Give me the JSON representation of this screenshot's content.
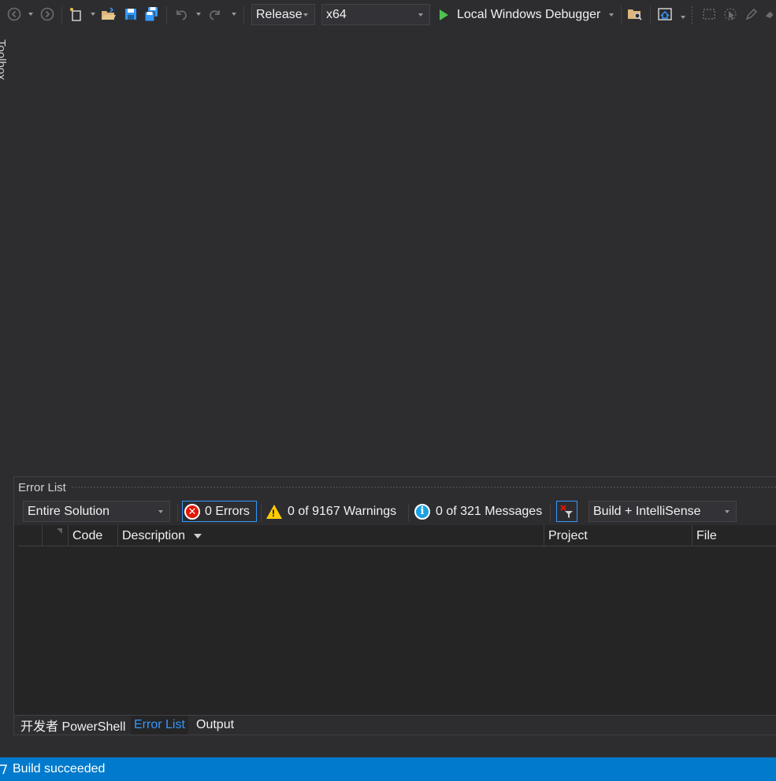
{
  "toolbar": {
    "configuration": "Release",
    "platform": "x64",
    "run_label": "Local Windows Debugger",
    "icons": [
      "back-icon",
      "forward-icon",
      "new-project-icon",
      "open-file-icon",
      "save-icon",
      "save-all-icon",
      "undo-icon",
      "redo-icon",
      "find-in-files-icon",
      "browser-icon",
      "select-icon",
      "cursor-icon",
      "pen-icon"
    ]
  },
  "side_tabs": {
    "toolbox": "Toolbox"
  },
  "error_list": {
    "title": "Error List",
    "scope": "Entire Solution",
    "errors_label": "0 Errors",
    "warnings_label": "0 of 9167 Warnings",
    "messages_label": "0 of 321 Messages",
    "source_filter": "Build + IntelliSense",
    "columns": {
      "code": "Code",
      "description": "Description",
      "project": "Project",
      "file": "File"
    }
  },
  "bottom_tabs": [
    "开发者 PowerShell",
    "Error List",
    "Output"
  ],
  "status": {
    "message": "Build succeeded"
  },
  "colors": {
    "background": "#2d2d30",
    "statusbar": "#007acc",
    "accent": "#3399ff",
    "run_green": "#4ec24f",
    "error_red": "#e51400",
    "warning_yellow": "#ffcc00",
    "info_blue": "#1ba1e2"
  }
}
